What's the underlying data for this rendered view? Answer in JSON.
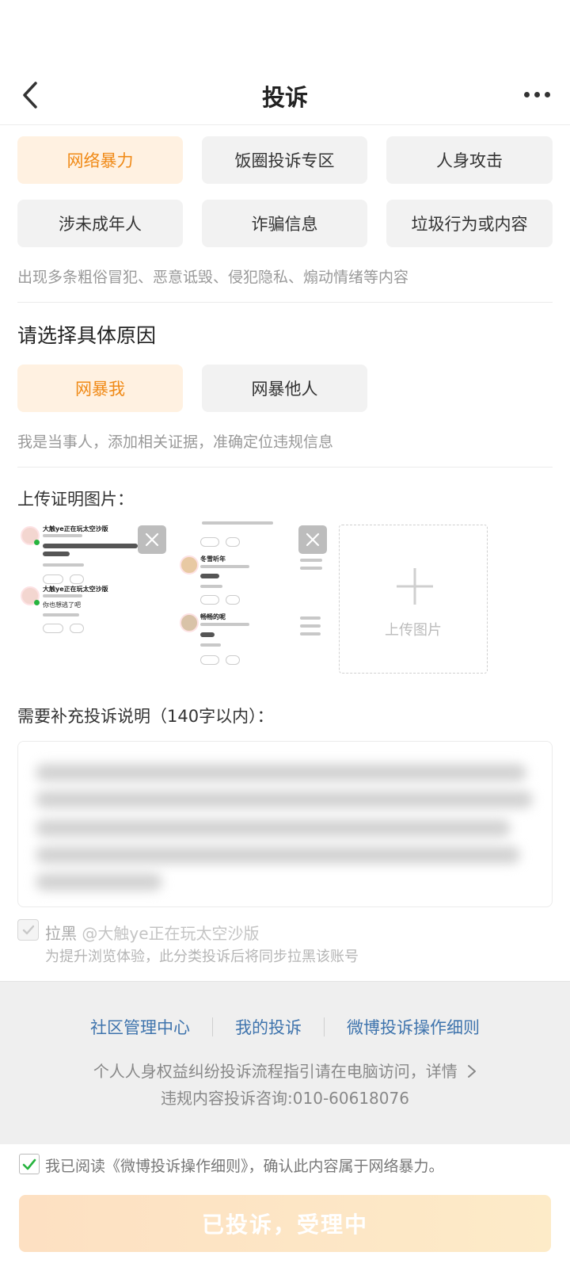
{
  "header": {
    "title": "投诉",
    "back_icon": "chevron-left-icon",
    "more_icon": "more-horizontal-icon"
  },
  "categories": [
    {
      "label": "网络暴力",
      "active": true
    },
    {
      "label": "饭圈投诉专区",
      "active": false
    },
    {
      "label": "人身攻击",
      "active": false
    },
    {
      "label": "涉未成年人",
      "active": false
    },
    {
      "label": "诈骗信息",
      "active": false
    },
    {
      "label": "垃圾行为或内容",
      "active": false
    }
  ],
  "category_desc": "出现多条粗俗冒犯、恶意诋毁、侵犯隐私、煽动情绪等内容",
  "reason_section": {
    "title": "请选择具体原因",
    "options": [
      {
        "label": "网暴我",
        "active": true
      },
      {
        "label": "网暴他人",
        "active": false
      }
    ],
    "desc": "我是当事人，添加相关证据，准确定位违规信息"
  },
  "upload": {
    "label": "上传证明图片：",
    "add_text": "上传图片",
    "thumb1_text": [
      "大触ye正在玩太空沙版",
      "你也想逃了吧",
      "大触ye正在玩太空沙版"
    ],
    "thumb2_text": [
      "冬雪听年",
      "畅畅的呢"
    ]
  },
  "description": {
    "label": "需要补充投诉说明（140字以内）："
  },
  "block": {
    "prefix": "拉黑 ",
    "handle": "@大触ye正在玩太空沙版",
    "hint": "为提升浏览体验，此分类投诉后将同步拉黑该账号",
    "checked": true
  },
  "footer": {
    "links": [
      "社区管理中心",
      "我的投诉",
      "微博投诉操作细则"
    ],
    "guide_text": "个人人身权益纠纷投诉流程指引请在电脑访问，详情",
    "hotline": "违规内容投诉咨询:010-60618076"
  },
  "agreement": {
    "text": "我已阅读《微博投诉操作细则》，确认此内容属于网络暴力。",
    "checked": true
  },
  "submit": {
    "label": "已投诉，受理中"
  },
  "colors": {
    "accent": "#f08a17",
    "chip_active_bg": "#fff1e1",
    "link": "#3f74ad",
    "check": "#27b43f"
  }
}
